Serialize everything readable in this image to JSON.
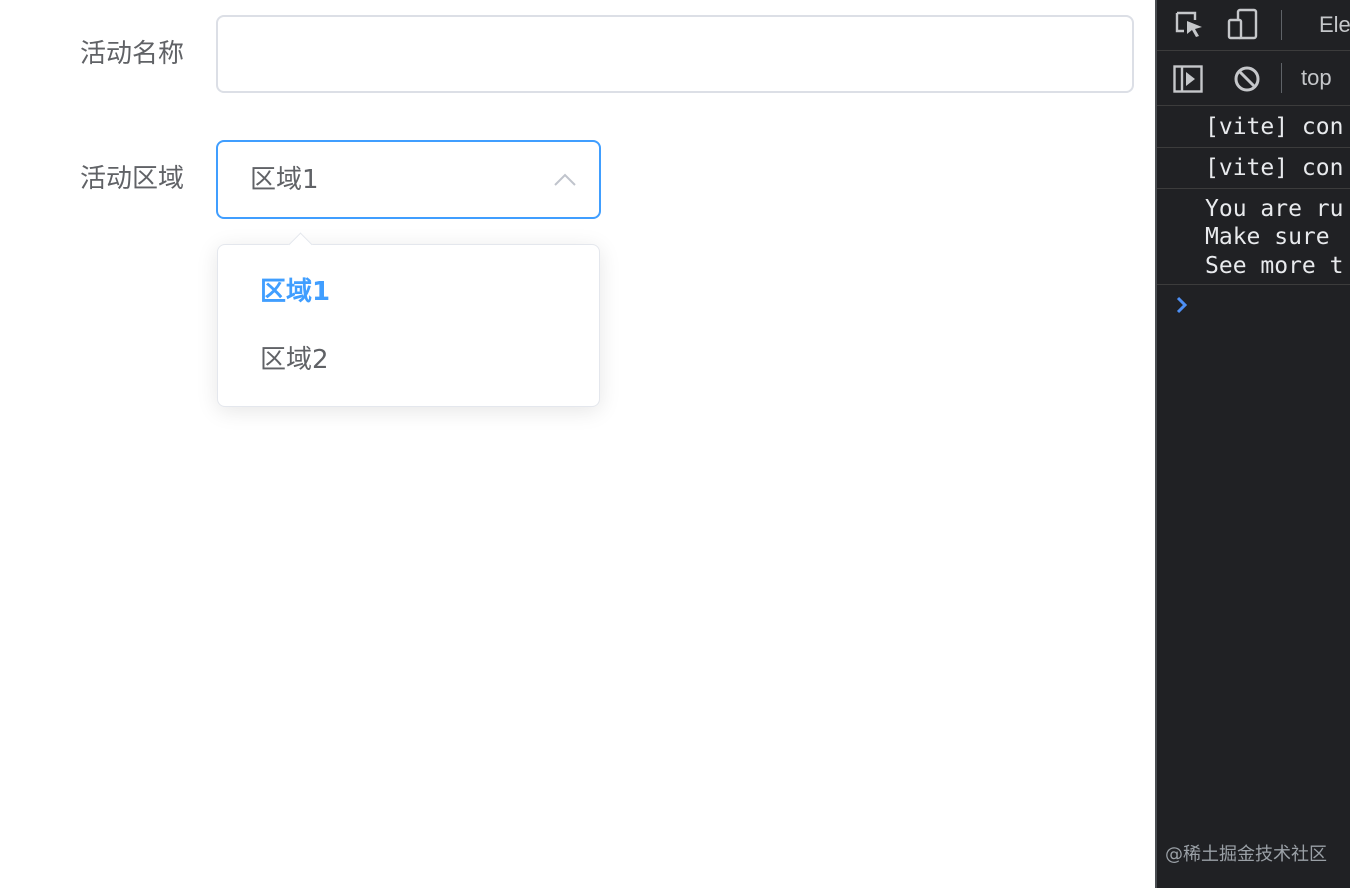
{
  "form": {
    "name_label": "活动名称",
    "name_value": "",
    "region_label": "活动区域",
    "region_value": "区域1",
    "region_options": [
      "区域1",
      "区域2"
    ],
    "selected_option": "区域1"
  },
  "colors": {
    "accent": "#409eff",
    "text": "#606266",
    "border": "#dcdfe6",
    "devtools_bg": "#202124"
  },
  "devtools": {
    "tab_label": "Ele",
    "context_label": "top",
    "console_lines": [
      "[vite] con",
      "[vite] con",
      "You are ru",
      "Make sure",
      "See more t"
    ],
    "icons": [
      "inspect-element-icon",
      "device-toolbar-icon",
      "sidebar-toggle-icon",
      "clear-console-icon",
      "prompt-chevron-icon"
    ]
  },
  "watermark": "@稀土掘金技术社区"
}
